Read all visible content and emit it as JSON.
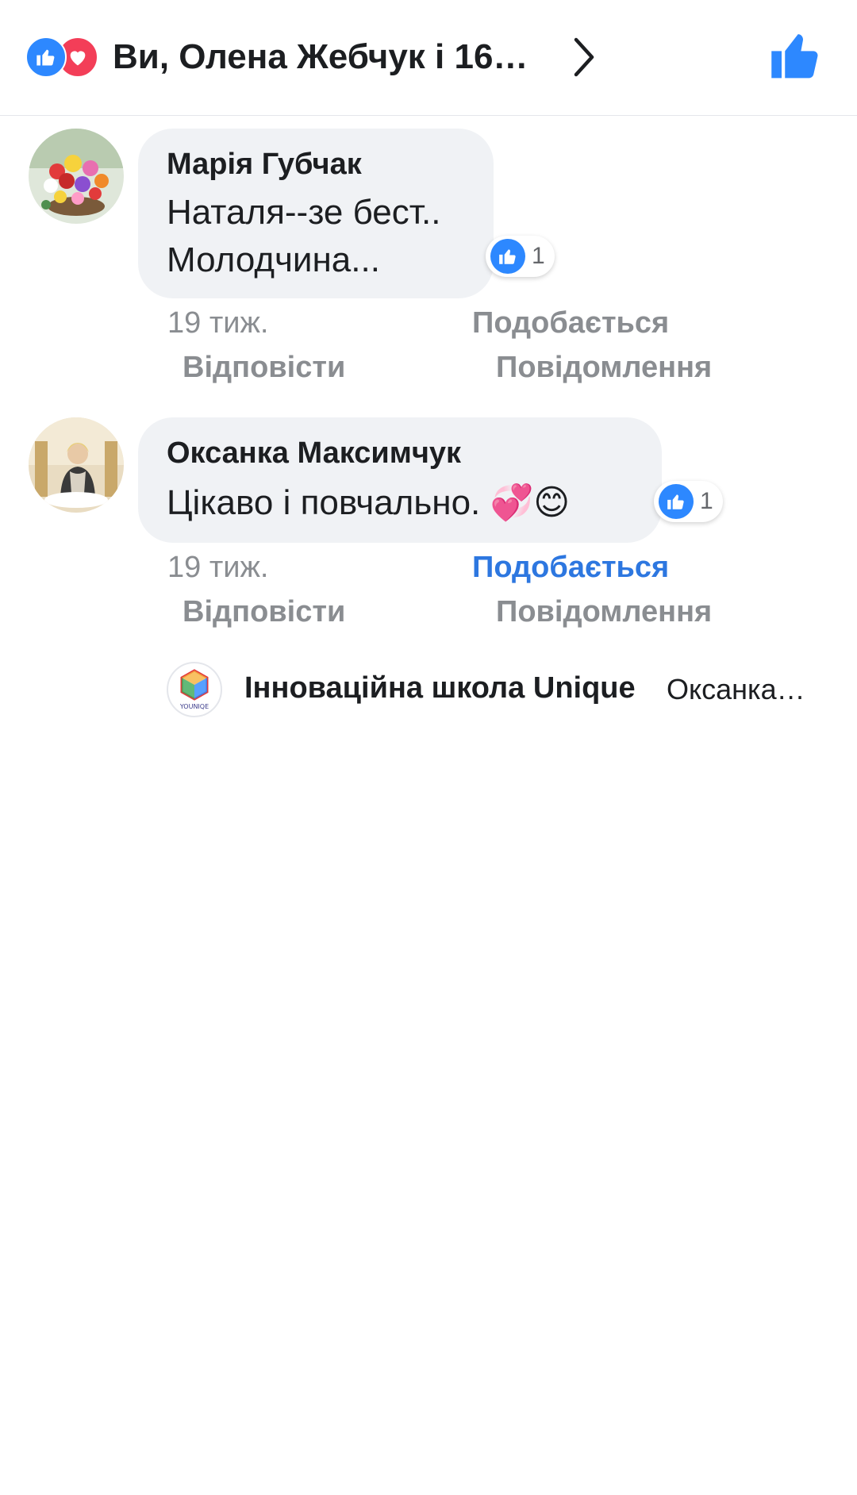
{
  "header": {
    "title": "Ви, Олена Жебчук і 16…",
    "reactions": [
      "like-icon",
      "love-icon"
    ],
    "colors": {
      "like": "#2d88ff",
      "love": "#f33e58"
    }
  },
  "comments": [
    {
      "author": "Марія Губчак",
      "lines": [
        "Наталя--зе бест..",
        "Молодчина..."
      ],
      "like_count": "1",
      "time": "19 тиж.",
      "like_label": "Подобається",
      "reply_label": "Відповісти",
      "message_label": "Повідомлення",
      "liked": false
    },
    {
      "author": "Оксанка Максимчук",
      "lines": [
        "Цікаво і повчально. 💞😊"
      ],
      "like_count": "1",
      "time": "19 тиж.",
      "like_label": "Подобається",
      "reply_label": "Відповісти",
      "message_label": "Повідомлення",
      "liked": true
    }
  ],
  "reply_preview": {
    "author": "Інноваційна школа Unique",
    "snippet": "Оксанка…",
    "logo_text": "YOUNIQE"
  }
}
